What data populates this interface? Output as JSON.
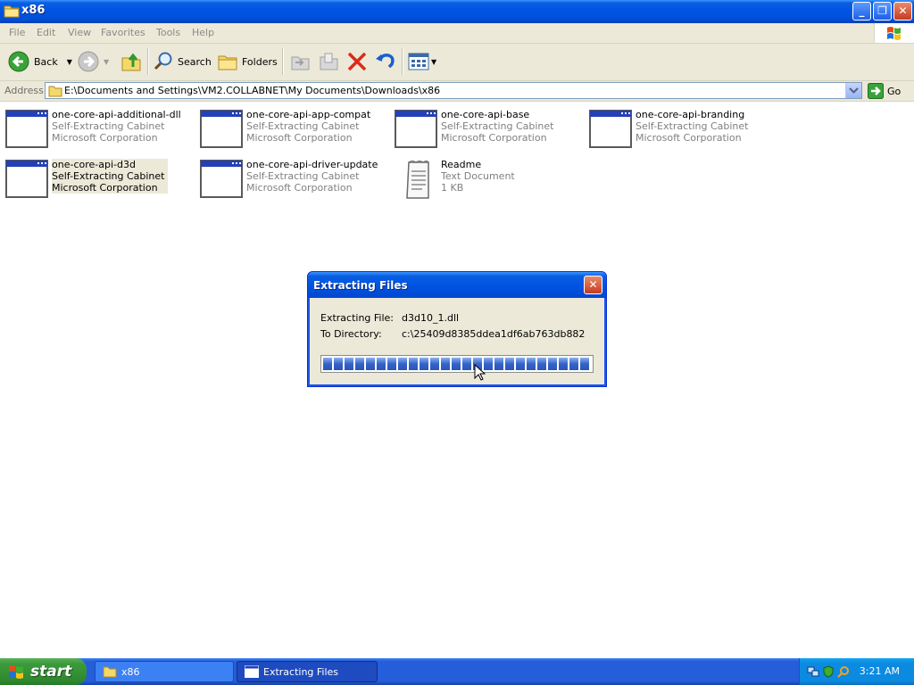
{
  "window": {
    "title": "x86"
  },
  "menu": [
    "File",
    "Edit",
    "View",
    "Favorites",
    "Tools",
    "Help"
  ],
  "toolbar": {
    "back_label": "Back",
    "search_label": "Search",
    "folders_label": "Folders"
  },
  "address": {
    "label": "Address",
    "path": "E:\\Documents and Settings\\VM2.COLLABNET\\My Documents\\Downloads\\x86",
    "go_label": "Go"
  },
  "files": [
    {
      "name": "one-core-api-additional-dll",
      "type": "Self-Extracting Cabinet",
      "detail": "Microsoft Corporation",
      "icon": "cabinet-icon"
    },
    {
      "name": "one-core-api-app-compat",
      "type": "Self-Extracting Cabinet",
      "detail": "Microsoft Corporation",
      "icon": "cabinet-icon"
    },
    {
      "name": "one-core-api-base",
      "type": "Self-Extracting Cabinet",
      "detail": "Microsoft Corporation",
      "icon": "cabinet-icon"
    },
    {
      "name": "one-core-api-branding",
      "type": "Self-Extracting Cabinet",
      "detail": "Microsoft Corporation",
      "icon": "cabinet-icon"
    },
    {
      "name": "one-core-api-d3d",
      "type": "Self-Extracting Cabinet",
      "detail": "Microsoft Corporation",
      "icon": "cabinet-icon",
      "selected": true
    },
    {
      "name": "one-core-api-driver-update",
      "type": "Self-Extracting Cabinet",
      "detail": "Microsoft Corporation",
      "icon": "cabinet-icon"
    },
    {
      "name": "Readme",
      "type": "Text Document",
      "detail": "1 KB",
      "icon": "text-document-icon"
    }
  ],
  "dialog": {
    "title": "Extracting Files",
    "file_label": "Extracting File:",
    "file_value": "d3d10_1.dll",
    "dir_label": "To Directory:",
    "dir_value": "c:\\25409d8385ddea1df6ab763db882",
    "progress_percent": 100
  },
  "taskbar": {
    "start_label": "start",
    "tasks": [
      {
        "label": "x86",
        "active": false
      },
      {
        "label": "Extracting Files",
        "active": true
      }
    ],
    "clock": "3:21 AM"
  },
  "colors": {
    "titlebar_blue": "#0054e3",
    "chrome_beige": "#ece9d8",
    "progress_blue": "#3563c7",
    "start_green": "#3c9a3c",
    "close_red": "#c63c1d"
  }
}
